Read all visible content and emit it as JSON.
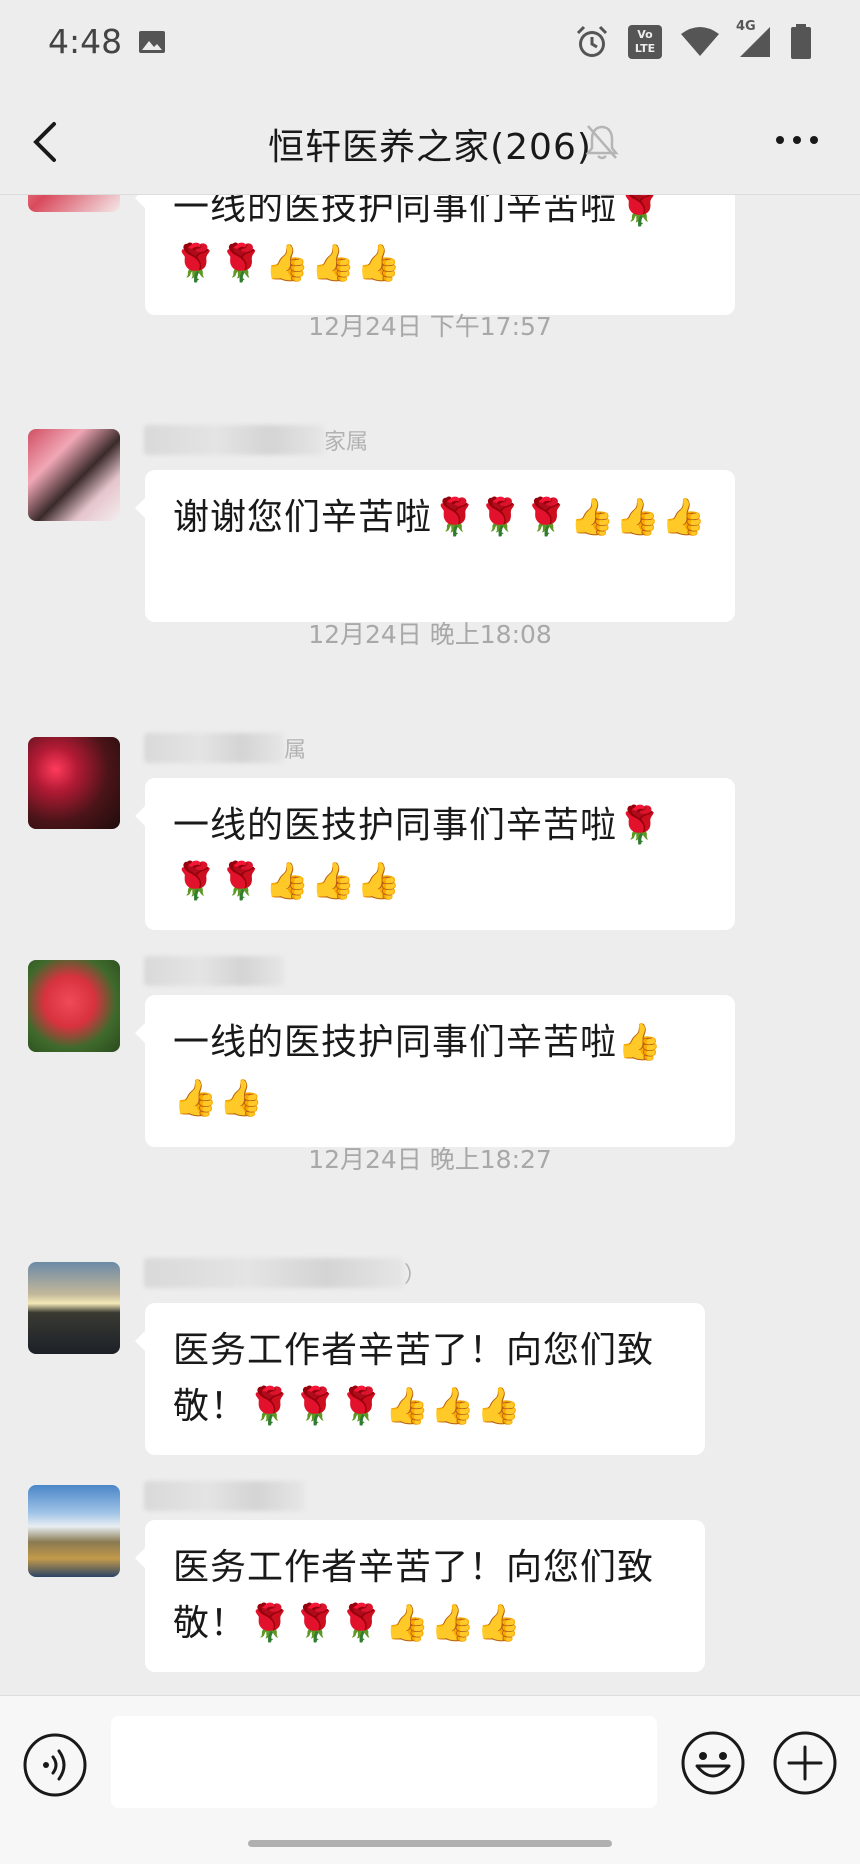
{
  "status_bar": {
    "time": "4:48",
    "icons": [
      "image-icon",
      "alarm-icon",
      "volte-icon",
      "wifi-icon",
      "signal-4g-icon",
      "battery-icon"
    ],
    "volte_label": "Vo LTE",
    "network_label": "4G"
  },
  "header": {
    "title": "恒轩医养之家(206)",
    "icons": [
      "back-arrow-icon",
      "mute-bell-icon",
      "more-icon"
    ]
  },
  "messages": [
    {
      "sender": "",
      "text": "一线的医技护同事们辛苦啦🌹🌹🌹👍👍👍"
    },
    {
      "timestamp": "12月24日 下午17:57",
      "sender": "家属",
      "text": "谢谢您们辛苦啦🌹🌹🌹👍👍👍"
    },
    {
      "timestamp": "12月24日 晚上18:08",
      "sender": "属",
      "text": "一线的医技护同事们辛苦啦🌹🌹🌹👍👍👍"
    },
    {
      "sender": "",
      "text": "一线的医技护同事们辛苦啦👍👍👍"
    },
    {
      "timestamp": "12月24日 晚上18:27",
      "sender": "）",
      "text": "医务工作者辛苦了！向您们致敬！🌹🌹🌹👍👍👍"
    },
    {
      "sender": "",
      "text": "医务工作者辛苦了！向您们致敬！🌹🌹🌹👍👍👍"
    }
  ],
  "input_bar": {
    "input_value": "",
    "icons": [
      "voice-icon",
      "emoji-face-icon",
      "plus-icon"
    ]
  },
  "colors": {
    "background": "#ededed",
    "bubble": "#ffffff",
    "timestamp_text": "#a8a8a8",
    "sender_text": "#b2b2b2"
  }
}
